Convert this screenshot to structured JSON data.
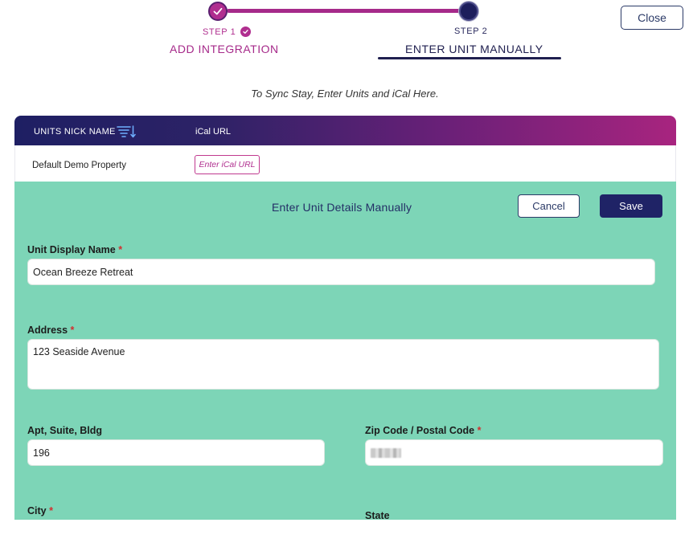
{
  "stepper": {
    "step1": {
      "num": "STEP 1",
      "title": "ADD INTEGRATION",
      "completed": true
    },
    "step2": {
      "num": "STEP 2",
      "title": "ENTER UNIT MANUALLY",
      "active": true
    }
  },
  "header": {
    "close_label": "Close"
  },
  "subtitle": "To Sync Stay, Enter Units and iCal Here.",
  "table": {
    "columns": [
      "UNITS NICK NAME",
      "iCal URL"
    ],
    "sort_icon": "sort-lines-icon",
    "rows": [
      {
        "name": "Default Demo Property",
        "ical_button": "Enter iCal URL"
      }
    ]
  },
  "form": {
    "title": "Enter Unit Details Manually",
    "cancel_label": "Cancel",
    "save_label": "Save",
    "unit_display_name": {
      "label": "Unit Display Name",
      "required_mark": "*",
      "value": "Ocean Breeze Retreat"
    },
    "address": {
      "label": "Address",
      "required_mark": "*",
      "value": "123 Seaside Avenue"
    },
    "apt": {
      "label": "Apt, Suite, Bldg",
      "value": "196"
    },
    "zip": {
      "label": "Zip Code / Postal Code",
      "required_mark": "*",
      "value": ""
    },
    "city": {
      "label": "City",
      "required_mark": "*"
    },
    "state": {
      "label": "State"
    }
  },
  "colors": {
    "accent_magenta": "#b02e8f",
    "navy": "#1f2366",
    "panel_green": "#7dd5b7",
    "required_red": "#d32f2f"
  }
}
